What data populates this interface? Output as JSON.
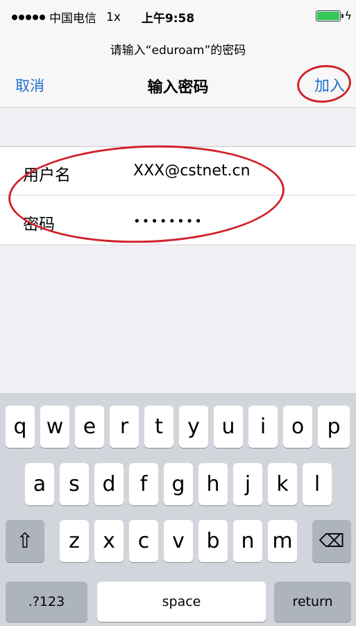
{
  "status_bar": {
    "carrier": "中国电信",
    "network": "1x",
    "time": "上午9:58"
  },
  "nav": {
    "prompt": "请输入“eduroam”的密码",
    "title": "输入密码",
    "cancel_label": "取消",
    "join_label": "加入"
  },
  "form": {
    "username_label": "用户名",
    "username_value": "XXX@cstnet.cn",
    "password_label": "密码",
    "password_value": "••••••••"
  },
  "keyboard": {
    "row1": [
      "q",
      "w",
      "e",
      "r",
      "t",
      "y",
      "u",
      "i",
      "o",
      "p"
    ],
    "row2": [
      "a",
      "s",
      "d",
      "f",
      "g",
      "h",
      "j",
      "k",
      "l"
    ],
    "row3": [
      "z",
      "x",
      "c",
      "v",
      "b",
      "n",
      "m"
    ],
    "shift_symbol": "⇧",
    "delete_symbol": "⌫",
    "numbers_label": ".?123",
    "space_label": "space",
    "return_label": "return"
  },
  "colors": {
    "accent": "#1f6fd0",
    "annotation": "#d0222a",
    "battery": "#34c759"
  }
}
